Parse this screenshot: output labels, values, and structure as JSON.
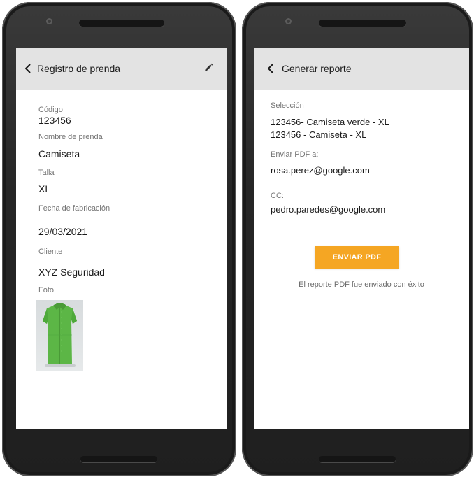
{
  "colors": {
    "appbar_bg": "#e3e3e3",
    "button_bg": "#f5a623",
    "button_text": "#ffffff",
    "label": "#757575",
    "phone_frame": "#2a2a2a"
  },
  "left_screen": {
    "title": "Registro de prenda",
    "back_icon": "chevron-left-icon",
    "edit_icon": "pencil-icon",
    "fields": {
      "codigo_label": "Código",
      "codigo_value": "123456",
      "nombre_label": "Nombre de prenda",
      "nombre_value": "Camiseta",
      "talla_label": "Talla",
      "talla_value": "XL",
      "fecha_label": "Fecha de fabricación",
      "fecha_value": "29/03/2021",
      "cliente_label": "Cliente",
      "cliente_value": "XYZ Seguridad",
      "foto_label": "Foto"
    },
    "photo_icon": "green-tunic-garment-image"
  },
  "right_screen": {
    "title": "Generar reporte",
    "back_icon": "chevron-left-icon",
    "seleccion_label": "Selección",
    "selection": [
      {
        "code": "123456",
        "rest": "- Camiseta verde - XL"
      },
      {
        "code": "123456",
        "rest": " - Camiseta - XL"
      }
    ],
    "enviar_label": "Enviar PDF a:",
    "enviar_value": "rosa.perez@google.com",
    "cc_label": "CC:",
    "cc_value": "pedro.paredes@google.com",
    "send_button": "ENVIAR PDF",
    "success_message": "El reporte PDF fue enviado con éxito"
  }
}
